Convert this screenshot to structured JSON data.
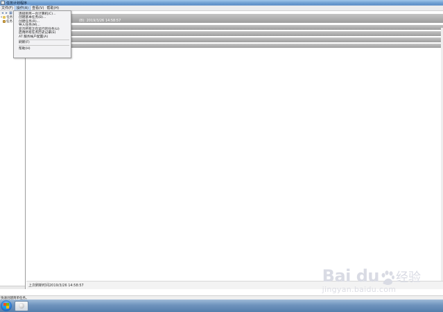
{
  "window": {
    "title": "任务计划程序"
  },
  "menubar": {
    "items": [
      "文件(F)",
      "操作(A)",
      "查看(V)",
      "帮助(H)"
    ],
    "active_index": 1
  },
  "tree": {
    "root_label": "任务计",
    "child_label": "任务"
  },
  "main": {
    "summary_text": "(B): 2019/3/26 14:58:57",
    "last_refresh": "上次刷新时间2019/3/26 14:58:57"
  },
  "dropdown": {
    "items": [
      "连接到另一台计算机(C)...",
      "创建基本任务(B)...",
      "创建任务(R)...",
      "导入任务(M)...",
      "显示所有正在运行的任务(U)",
      "启用所有任务历史记录(E)",
      "AT 服务帐户配置(A)",
      "刷新(F)",
      "帮助(H)"
    ]
  },
  "statusbar": {
    "text": "快速创建简单任务。"
  },
  "watermark": {
    "brand": "Bai du",
    "chinese": "经验",
    "url": "jingyan.baidu.com"
  },
  "colors": {
    "title_bar": "#6b9bd0",
    "menu_highlight": "#c7dcf5",
    "band_gray": "#9e9e9e",
    "taskbar": "#6f93bd"
  }
}
